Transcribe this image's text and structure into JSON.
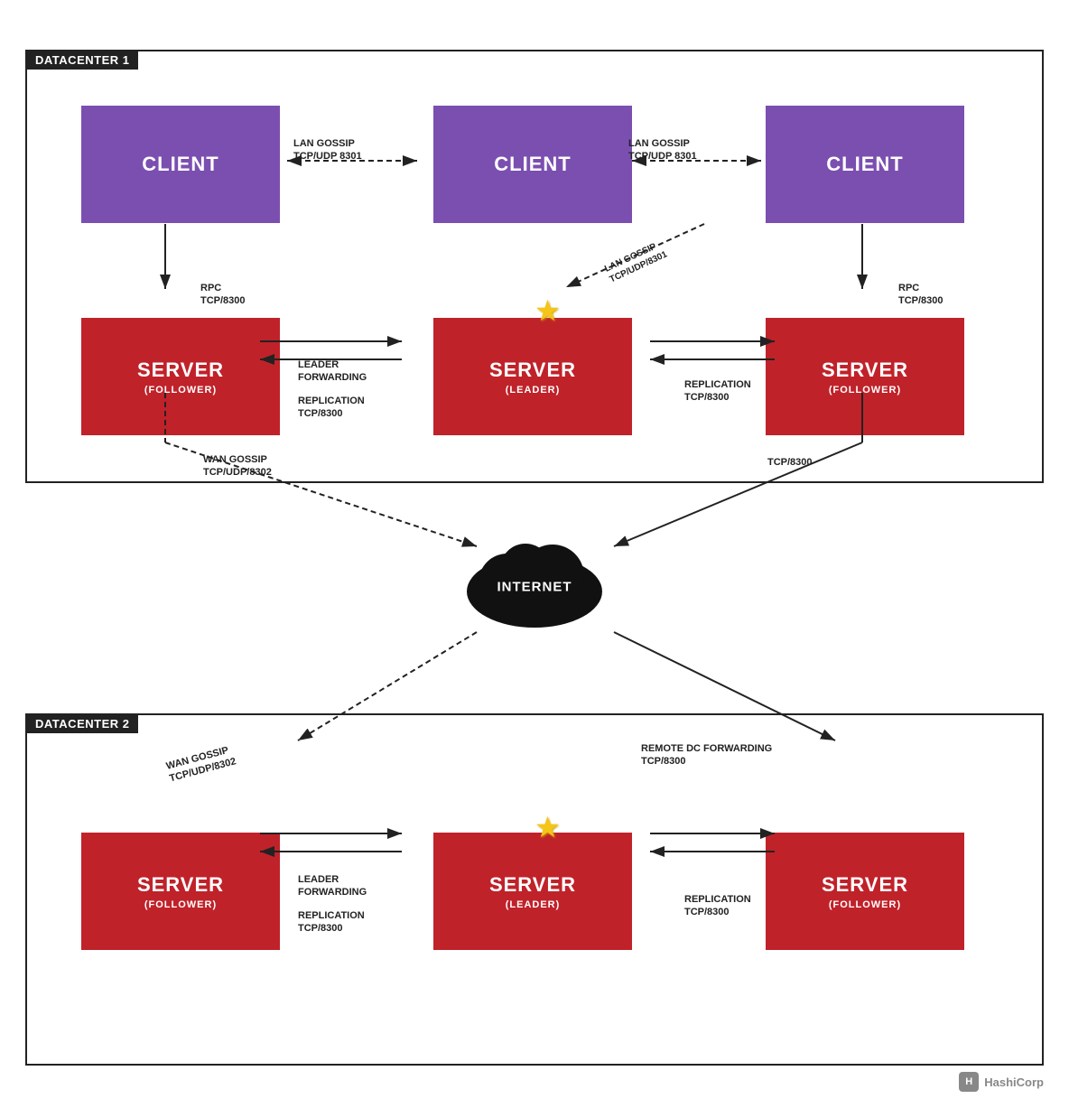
{
  "datacenter1": {
    "label": "DATACENTER 1"
  },
  "datacenter2": {
    "label": "DATACENTER 2"
  },
  "clients": [
    {
      "id": "client1",
      "label": "CLIENT"
    },
    {
      "id": "client2",
      "label": "CLIENT"
    },
    {
      "id": "client3",
      "label": "CLIENT"
    }
  ],
  "servers_dc1": [
    {
      "id": "server1",
      "label": "SERVER",
      "sublabel": "(FOLLOWER)"
    },
    {
      "id": "server2",
      "label": "SERVER",
      "sublabel": "(LEADER)"
    },
    {
      "id": "server3",
      "label": "SERVER",
      "sublabel": "(FOLLOWER)"
    }
  ],
  "servers_dc2": [
    {
      "id": "server4",
      "label": "SERVER",
      "sublabel": "(FOLLOWER)"
    },
    {
      "id": "server5",
      "label": "SERVER",
      "sublabel": "(LEADER)"
    },
    {
      "id": "server6",
      "label": "SERVER",
      "sublabel": "(FOLLOWER)"
    }
  ],
  "internet_label": "INTERNET",
  "arrows": {
    "lan_gossip_label": "LAN GOSSIP",
    "lan_gossip_port": "TCP/UDP 8301",
    "wan_gossip_label": "WAN GOSSIP",
    "wan_gossip_port": "TCP/UDP/8302",
    "rpc_label": "RPC",
    "rpc_port": "TCP/8300",
    "leader_forwarding_label": "LEADER\nFORWARDING",
    "replication_label": "REPLICATION",
    "replication_port": "TCP/8300",
    "remote_dc_label": "REMOTE DC FORWARDING",
    "remote_dc_port": "TCP/8300"
  },
  "hashicorp": {
    "logo_text": "HashiCorp"
  }
}
